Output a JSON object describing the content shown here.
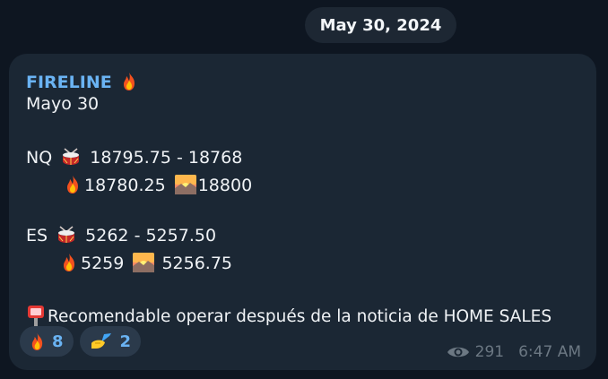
{
  "date_separator": "May 30, 2024",
  "message": {
    "channel_title": "FIRELINE",
    "title_emoji": "fire-icon",
    "lines": {
      "date_line": "Mayo 30",
      "nq_label": "NQ",
      "nq_range": "18795.75 - 18768",
      "nq_fire_value": "18780.25",
      "nq_sunrise_value": "18800",
      "es_label": "ES",
      "es_range": "5262 - 5257.50",
      "es_fire_value": "5259",
      "es_sunrise_value": "5256.75",
      "note": "Recomendable operar después de la noticia de HOME SALES"
    },
    "reactions": [
      {
        "icon": "fire-icon",
        "count": "8"
      },
      {
        "icon": "writing-hand-icon",
        "count": "2"
      }
    ],
    "views": "291",
    "time": "6:47 AM"
  },
  "colors": {
    "background": "#0e1621",
    "bubble": "#1b2734",
    "accent": "#6ab3f3",
    "meta": "#6c7883"
  }
}
